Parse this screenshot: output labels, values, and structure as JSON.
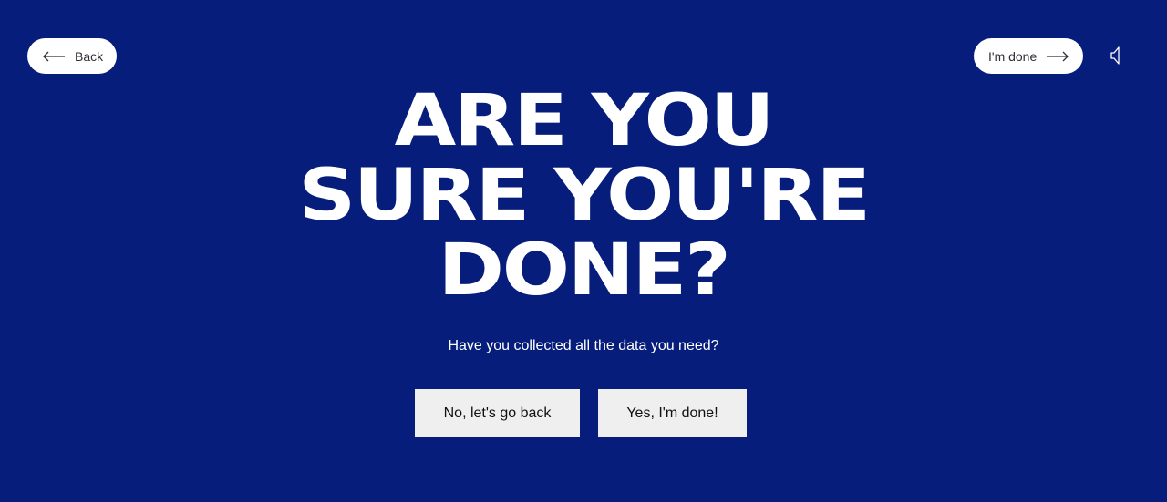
{
  "nav": {
    "back_label": "Back",
    "done_label": "I'm done"
  },
  "icons": {
    "back": "arrow-left-icon",
    "done": "arrow-right-icon",
    "sound": "speaker-icon"
  },
  "headline": {
    "line1": "ARE YOU",
    "line2": "SURE YOU'RE",
    "line3": "DONE?"
  },
  "subtitle": "Have you collected all the data you need?",
  "actions": {
    "no_label": "No, let's go back",
    "yes_label": "Yes, I'm done!"
  },
  "colors": {
    "background": "#071d7c",
    "text": "#ffffff",
    "button_bg": "#efefef"
  }
}
